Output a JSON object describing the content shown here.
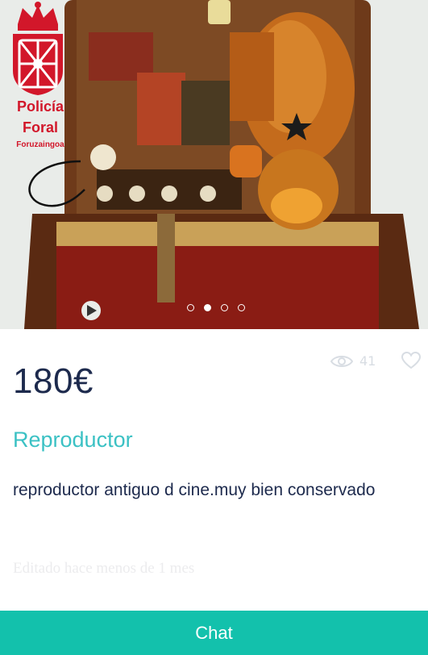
{
  "logo": {
    "line1": "Policía",
    "line2": "Foral",
    "line3": "Foruzaingoa"
  },
  "gallery": {
    "total_images": 4,
    "active_index": 2
  },
  "listing": {
    "price": "180€",
    "views": "41",
    "title": "Reproductor",
    "description": "reproductor antiguo d cine.muy bien conservado",
    "posted": "Editado hace menos de 1 mes"
  },
  "chat": {
    "label": "Chat"
  },
  "colors": {
    "accent": "#13c1ac",
    "title": "#3bc1c4",
    "price": "#1d2a4d",
    "logo_red": "#d2172a"
  },
  "icons": {
    "views": "eye-icon",
    "favorite": "heart-icon"
  }
}
